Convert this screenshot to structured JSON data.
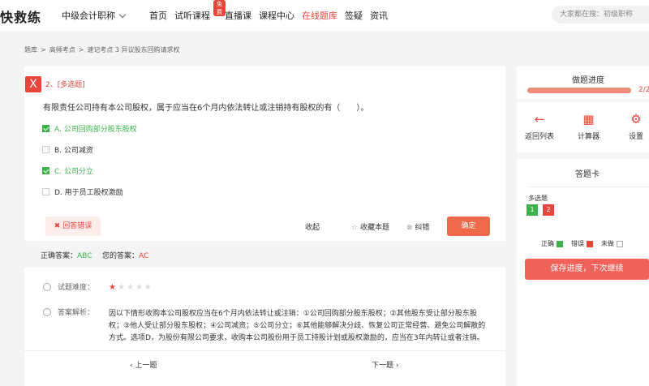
{
  "header": {
    "logo": "快救练",
    "course": "中级会计职称",
    "nav": [
      {
        "label": "首页"
      },
      {
        "label": "试听课程",
        "badge": "免费"
      },
      {
        "label": "直播课"
      },
      {
        "label": "课程中心"
      },
      {
        "label": "在线题库",
        "active": true
      },
      {
        "label": "签疑"
      },
      {
        "label": "资讯"
      }
    ],
    "search_placeholder": "大家都在搜：初级职称"
  },
  "breadcrumb": [
    "题库",
    ">",
    "高频考点",
    ">",
    "速记考点 3 异议股东回购请求权"
  ],
  "question": {
    "status_icon": "X",
    "type": "2、[多选题]",
    "stem": "有限责任公司持有本公司股权，属于应当在6个月内依法转让或注销持有股权的有（　　）。",
    "options": [
      {
        "label": "A. 公司回购部分股东股权",
        "checked": true
      },
      {
        "label": "B. 公司减资",
        "checked": false
      },
      {
        "label": "C. 公司分立",
        "checked": true
      },
      {
        "label": "D. 用于员工股权激励",
        "checked": false
      }
    ],
    "wrong_label": "回答错误",
    "collapse_label": "收起",
    "favorite_label": "收藏本题",
    "report_label": "纠错",
    "confirm_label": "确定"
  },
  "answer": {
    "correct_label": "正确答案：",
    "correct_value": "ABC",
    "yours_label": "您的答案：",
    "yours_value": "AC"
  },
  "analysis": {
    "difficulty_label": "试题难度：",
    "difficulty": 1,
    "difficulty_max": 5,
    "analysis_label": "答案解析：",
    "text": "因以下情形收购本公司股权应当在6个月内依法转让或注销：①公司回购部分股东股权；②其他股东受让部分股东股权；③他人受让部分股东股权；④公司减资；⑤公司分立；⑥其他能够解决分歧、恢复公司正常经营、避免公司解散的方式。选项D，为股份有限公司要求，收购本公司股份用于员工持股计划或股权激励的，应当在3年内转让或者注销。"
  },
  "pager": {
    "prev": "‹ 上一题",
    "next": "下一题 ›"
  },
  "progress": {
    "title": "做题进度",
    "text": "2/2",
    "fraction": 1.0
  },
  "tools": [
    {
      "icon": "arrow-left-icon",
      "label": "返回列表"
    },
    {
      "icon": "calculator-icon",
      "label": "计算器"
    },
    {
      "icon": "gear-icon",
      "label": "设置"
    }
  ],
  "answer_card": {
    "title": "答题卡",
    "section": "多选题",
    "numbers": [
      {
        "n": "1",
        "status": "correct"
      },
      {
        "n": "2",
        "status": "wrong"
      }
    ],
    "legend": {
      "correct": "正确",
      "wrong": "错误",
      "undone": "未做"
    },
    "save_label": "保存进度，下次继续"
  },
  "colors": {
    "accent": "#e8463c",
    "correct": "#3bb34a",
    "wrong": "#e8463c"
  }
}
